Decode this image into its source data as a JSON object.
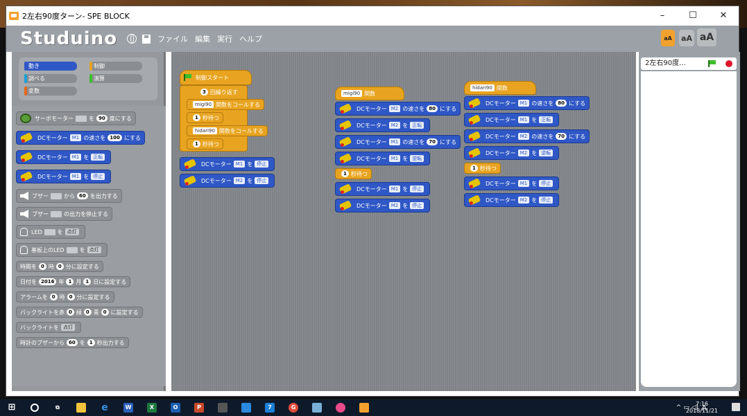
{
  "window": {
    "title": "2左右90度ターン- SPE BLOCK",
    "min": "–",
    "max": "☐",
    "close": "✕"
  },
  "menubar": {
    "logo": "Studuino",
    "items": [
      "ファイル",
      "編集",
      "実行",
      "ヘルプ"
    ],
    "size_buttons": [
      "aA",
      "aA",
      "aA"
    ]
  },
  "categories": [
    {
      "label": "動き",
      "color": "#2f57c5",
      "active": true
    },
    {
      "label": "制御",
      "color": "#e8a420",
      "active": false
    },
    {
      "label": "調べる",
      "color": "#1aa0d8",
      "active": false
    },
    {
      "label": "演算",
      "color": "#3cbf2a",
      "active": false
    },
    {
      "label": "変数",
      "color": "#e8661a",
      "active": false
    }
  ],
  "palette": {
    "servo": {
      "label": "サーボモーター",
      "to": "を",
      "value": "90",
      "unit": "度にする"
    },
    "dc_speed": {
      "label": "DCモーター",
      "port": "M1",
      "text": "の速さを",
      "value": "100",
      "unit": "にする"
    },
    "dc_rotate": {
      "label": "DCモーター",
      "port": "M1",
      "to": "を",
      "state": "正転"
    },
    "dc_stop": {
      "label": "DCモーター",
      "port": "M1",
      "to": "を",
      "state": "停止"
    },
    "buzzer": {
      "label": "ブザー",
      "from": "から",
      "value": "60",
      "unit": "を出力する"
    },
    "buzzer_stop": {
      "label": "ブザー",
      "text": "の出力を停止する"
    },
    "led": {
      "label": "LED",
      "to": "を",
      "state": "点灯"
    },
    "board_led": {
      "label": "基板上のLED",
      "to": "を",
      "state": "点灯"
    },
    "time_set": {
      "a": "時間を",
      "h": "0",
      "t1": "時",
      "m": "0",
      "t2": "分に設定する"
    },
    "date_set": {
      "a": "日付を",
      "y": "2016",
      "t1": "年",
      "mo": "1",
      "t2": "月",
      "d": "1",
      "t3": "日に設定する"
    },
    "alarm_set": {
      "a": "アラームを",
      "h": "0",
      "t1": "時",
      "m": "0",
      "t2": "分に設定する"
    },
    "backlight_color": {
      "a": "バックライトを赤",
      "r": "0",
      "t1": "緑",
      "g": "0",
      "t2": "青",
      "b": "0",
      "t3": "に設定する"
    },
    "backlight": {
      "a": "バックライトを",
      "state": "点灯"
    },
    "clock_buzzer": {
      "a": "時計のブザーから",
      "v": "60",
      "t1": "を",
      "s": "1",
      "t2": "秒出力する"
    }
  },
  "script": {
    "start": {
      "hat": "制御スタート",
      "repeat": {
        "n": "3",
        "label": "回繰り返す"
      },
      "call1": {
        "fn": "migi90",
        "label": "関数をコールする"
      },
      "wait1": {
        "n": "1",
        "label": "秒待つ"
      },
      "call2": {
        "fn": "hidari90",
        "label": "関数をコールする"
      },
      "wait2": {
        "n": "1",
        "label": "秒待つ"
      },
      "stop1": {
        "label": "DCモーター",
        "port": "M1",
        "to": "を",
        "state": "停止"
      },
      "stop2": {
        "label": "DCモーター",
        "port": "M2",
        "to": "を",
        "state": "停止"
      }
    },
    "migi": {
      "hat_fn": "migi90",
      "hat_label": "関数",
      "blocks": [
        {
          "label": "DCモーター",
          "port": "M2",
          "text": "の速さを",
          "value": "80",
          "unit": "にする"
        },
        {
          "label": "DCモーター",
          "port": "M2",
          "text": "を",
          "state": "正転"
        },
        {
          "label": "DCモーター",
          "port": "M1",
          "text": "の速さを",
          "value": "70",
          "unit": "にする"
        },
        {
          "label": "DCモーター",
          "port": "M1",
          "text": "を",
          "state": "逆転"
        }
      ],
      "wait": {
        "n": "1",
        "label": "秒待つ"
      },
      "stops": [
        {
          "label": "DCモーター",
          "port": "M1",
          "text": "を",
          "state": "停止"
        },
        {
          "label": "DCモーター",
          "port": "M2",
          "text": "を",
          "state": "停止"
        }
      ]
    },
    "hidari": {
      "hat_fn": "hidari90",
      "hat_label": "関数",
      "blocks": [
        {
          "label": "DCモーター",
          "port": "M1",
          "text": "の速さを",
          "value": "80",
          "unit": "にする"
        },
        {
          "label": "DCモーター",
          "port": "M1",
          "text": "を",
          "state": "正転"
        },
        {
          "label": "DCモーター",
          "port": "M2",
          "text": "の速さを",
          "value": "70",
          "unit": "にする"
        },
        {
          "label": "DCモーター",
          "port": "M2",
          "text": "を",
          "state": "逆転"
        }
      ],
      "wait": {
        "n": "1",
        "label": "秒待つ"
      },
      "stops": [
        {
          "label": "DCモーター",
          "port": "M1",
          "text": "を",
          "state": "停止"
        },
        {
          "label": "DCモーター",
          "port": "M2",
          "text": "を",
          "state": "停止"
        }
      ]
    }
  },
  "stage": {
    "title": "2左右90度..."
  },
  "taskbar": {
    "time": "7:16",
    "date": "2018/11/21",
    "ime": "A"
  }
}
